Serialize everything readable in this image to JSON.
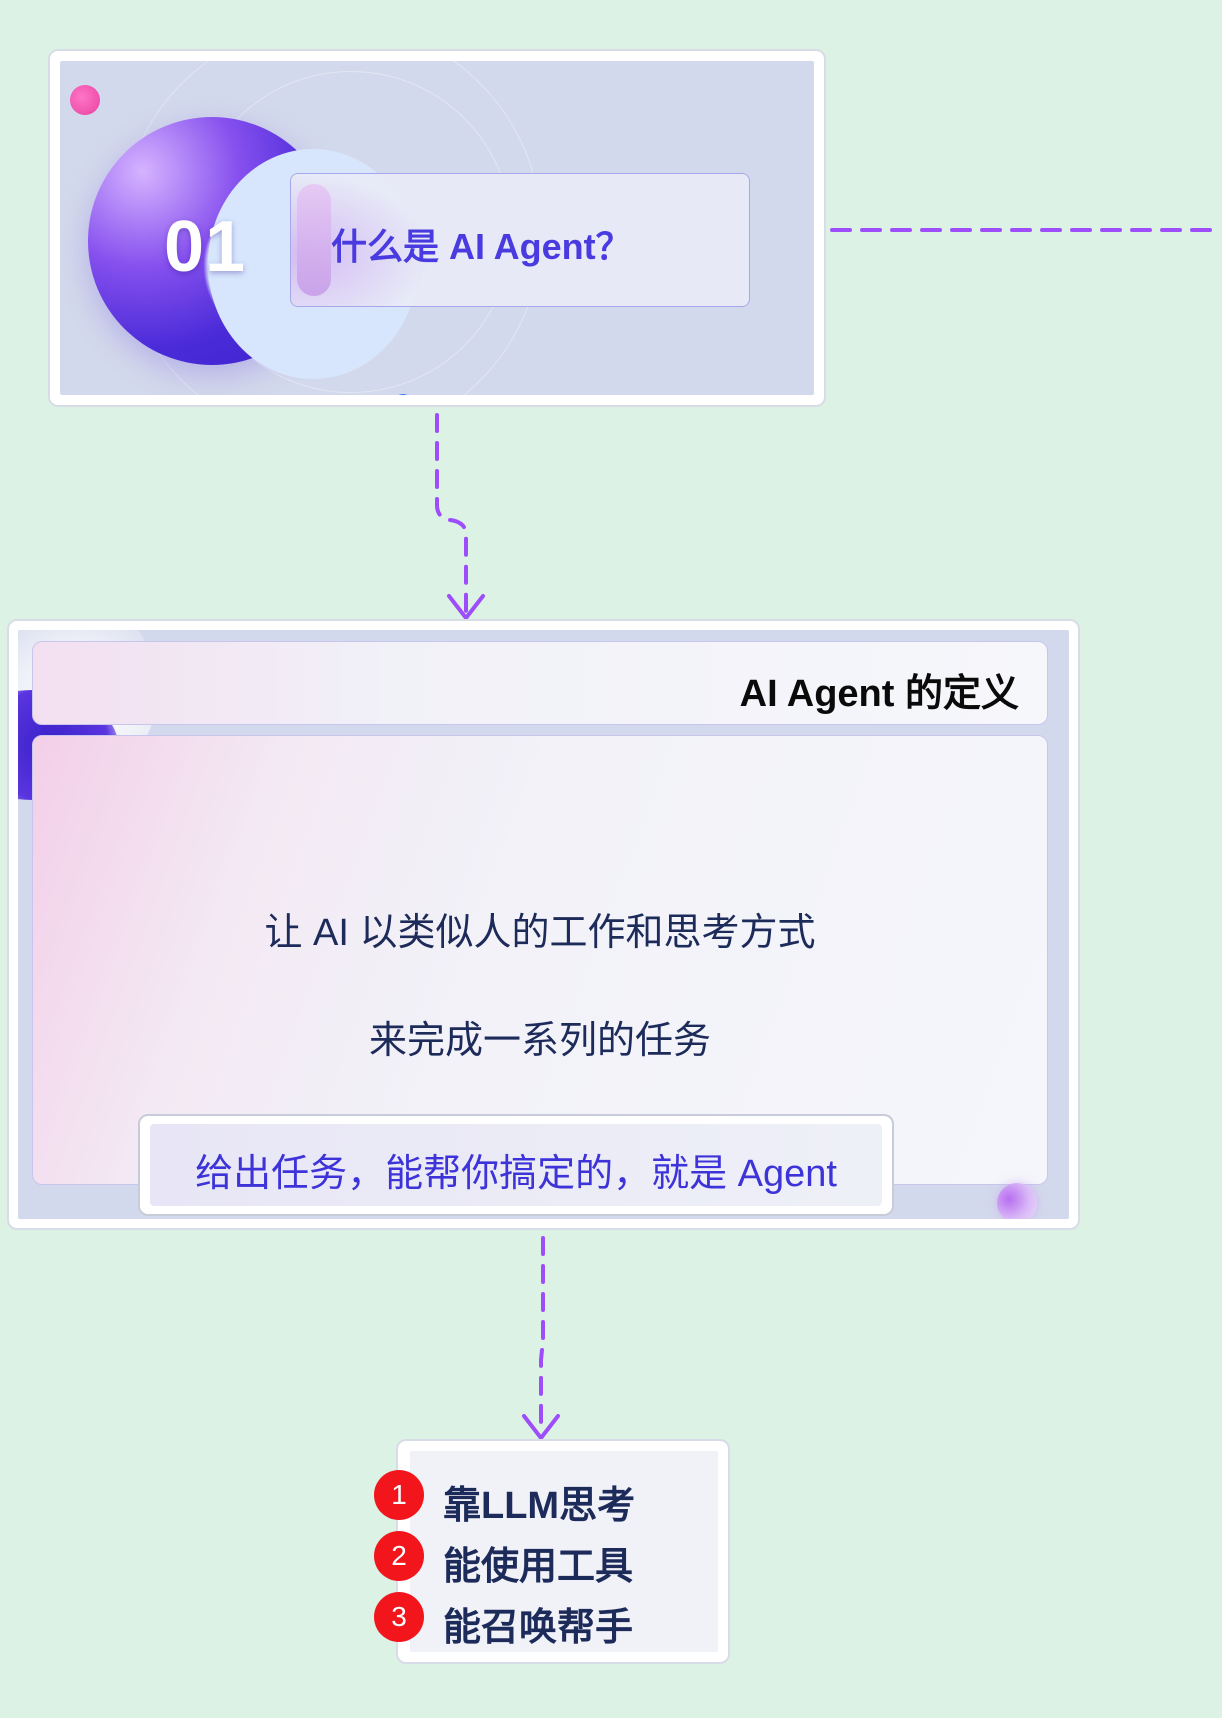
{
  "card01": {
    "number": "01",
    "title": "什么是 AI Agent？"
  },
  "definition": {
    "header": "AI Agent 的定义",
    "line1": "让 AI 以类似人的工作和思考方式",
    "line2": "来完成一系列的任务",
    "summary": "给出任务，能帮你搞定的，就是 Agent"
  },
  "capabilities": {
    "items": [
      {
        "num": "1",
        "label": "靠LLM思考"
      },
      {
        "num": "2",
        "label": "能使用工具"
      },
      {
        "num": "3",
        "label": "能召唤帮手"
      }
    ]
  },
  "colors": {
    "background": "#dcf2e4",
    "connector": "#9d4dfa",
    "title_text": "#4a3be0",
    "body_text": "#1d2b5a",
    "badge_red": "#f2151c"
  }
}
